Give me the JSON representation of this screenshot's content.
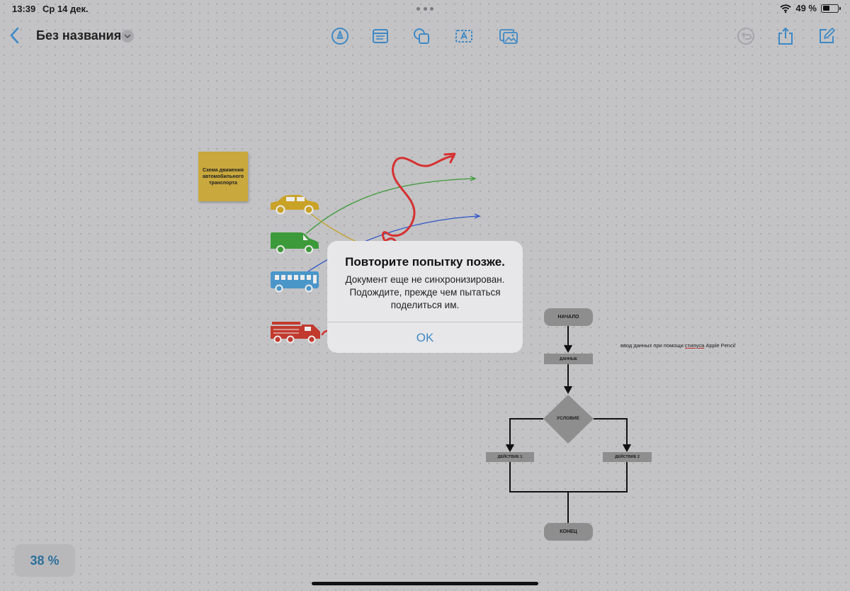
{
  "status_bar": {
    "time": "13:39",
    "date": "Ср 14 дек.",
    "battery_text": "49 %",
    "battery_level": 0.49
  },
  "toolbar": {
    "title": "Без названия",
    "icons": [
      "back-chevron-icon",
      "pen-tool-icon",
      "note-card-icon",
      "shapes-icon",
      "text-box-icon",
      "media-icon",
      "undo-icon",
      "share-icon",
      "compose-icon"
    ]
  },
  "board": {
    "sticky_note": "Схема движения автомобильного транспорта",
    "flowchart": {
      "start": "НАЧАЛО",
      "data": "ДАННЫЕ",
      "condition": "УСЛОВИЕ",
      "action1": "ДЕЙСТВИЕ 1",
      "action2": "ДЕЙСТВИЕ 2",
      "end": "КОНЕЦ"
    },
    "pencil_note_prefix": "ввод данных при помощи ",
    "pencil_note_underlined": "стилуса",
    "pencil_note_suffix": " Apple Pencil"
  },
  "zoom": "38 %",
  "alert": {
    "title": "Повторите попытку позже.",
    "message": "Документ еще не синхронизирован. Подождите, прежде чем пытаться поделиться им.",
    "ok": "OK"
  },
  "colors": {
    "accent": "#3e89c6",
    "car": "#c9a327",
    "van": "#3d9a3a",
    "bus": "#4a96c9",
    "firetruck": "#c23a2e",
    "sticky": "#c9a83d"
  }
}
